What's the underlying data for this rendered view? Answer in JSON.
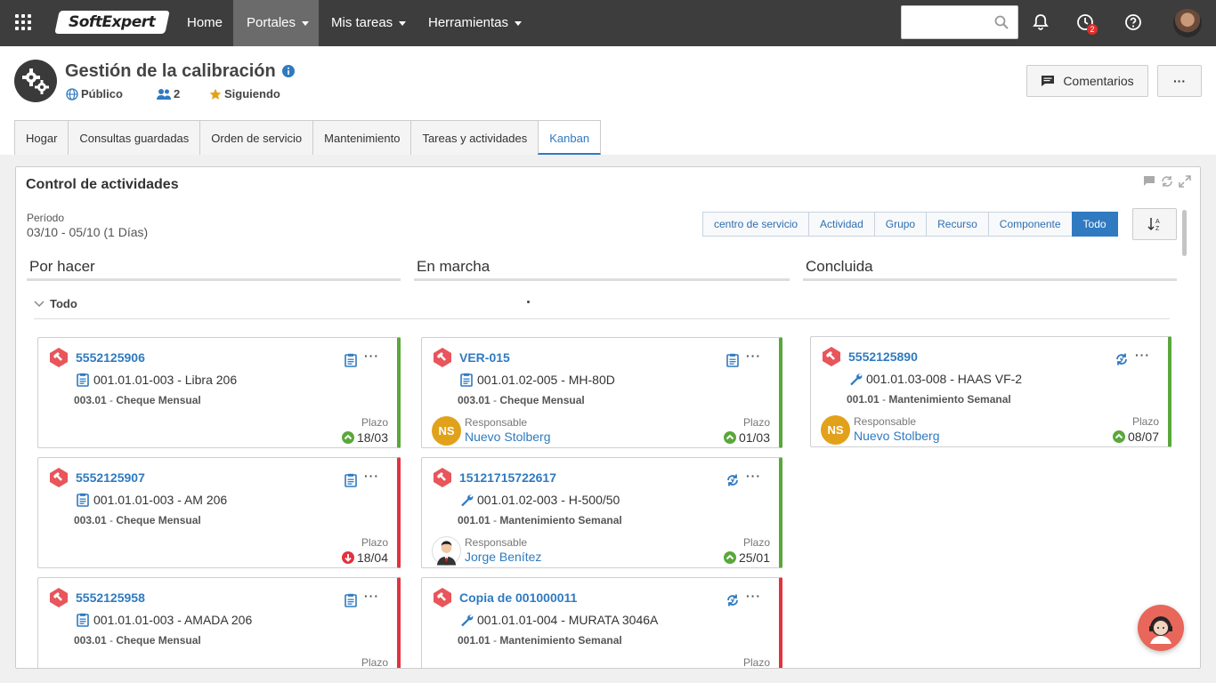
{
  "topnav": {
    "logo": "SoftExpert",
    "items": [
      {
        "label": "Home",
        "dropdown": false
      },
      {
        "label": "Portales",
        "dropdown": true
      },
      {
        "label": "Mis tareas",
        "dropdown": true
      },
      {
        "label": "Herramientas",
        "dropdown": true
      }
    ],
    "search_value": "",
    "badge_count": "2"
  },
  "header": {
    "title": "Gestión de la calibración",
    "visibility": "Público",
    "members": "2",
    "following": "Siguiendo",
    "comments_label": "Comentarios",
    "more_label": "···"
  },
  "tabs": [
    "Hogar",
    "Consultas guardadas",
    "Orden de servicio",
    "Mantenimiento",
    "Tareas y actividades",
    "Kanban"
  ],
  "active_tab": "Kanban",
  "panel": {
    "title": "Control de actividades",
    "period_label": "Período",
    "period_value": "03/10 - 05/10 (1 Días)",
    "filters": [
      "centro de servicio",
      "Actividad",
      "Grupo",
      "Recurso",
      "Componente",
      "Todo"
    ],
    "active_filter": "Todo",
    "group_label": "Todo"
  },
  "columns": [
    "Por hacer",
    "En marcha",
    "Concluida"
  ],
  "labels": {
    "plazo": "Plazo",
    "responsable": "Responsable"
  },
  "cards": [
    {
      "id": "5552125906",
      "item": "001.01.01-003 - Libra 206",
      "activity_code": "003.01",
      "activity": "Cheque Mensual",
      "date": "18/03",
      "status": "up",
      "accent": "green",
      "type": "clipboard"
    },
    {
      "id": "5552125907",
      "item": "001.01.01-003 - AM 206",
      "activity_code": "003.01",
      "activity": "Cheque Mensual",
      "date": "18/04",
      "status": "down",
      "accent": "red",
      "type": "clipboard"
    },
    {
      "id": "5552125958",
      "item": "001.01.01-003 - AMADA 206",
      "activity_code": "003.01",
      "activity": "Cheque Mensual",
      "date": "",
      "status": "",
      "accent": "red",
      "type": "clipboard"
    },
    {
      "id": "VER-015",
      "item": "001.01.02-005 - MH-80D",
      "activity_code": "003.01",
      "activity": "Cheque Mensual",
      "responsible": "Nuevo Stolberg",
      "initials": "NS",
      "date": "01/03",
      "status": "up",
      "accent": "green",
      "type": "clipboard"
    },
    {
      "id": "15121715722617",
      "item": "001.01.02-003 - H-500/50",
      "activity_code": "001.01",
      "activity": "Mantenimiento Semanal",
      "responsible": "Jorge Benítez",
      "initials": "",
      "date": "25/01",
      "status": "up",
      "accent": "green",
      "type": "cycle"
    },
    {
      "id": "Copia de 001000011",
      "item": "001.01.01-004 - MURATA 3046A",
      "activity_code": "001.01",
      "activity": "Mantenimiento Semanal",
      "date": "",
      "status": "",
      "accent": "red",
      "type": "cycle"
    },
    {
      "id": "5552125890",
      "item": "001.01.03-008 - HAAS VF-2",
      "activity_code": "001.01",
      "activity": "Mantenimiento Semanal",
      "responsible": "Nuevo Stolberg",
      "initials": "NS",
      "date": "08/07",
      "status": "up",
      "accent": "green",
      "type": "cycle"
    }
  ],
  "colors": {
    "topbar": "#3d3d3d",
    "accent": "#2f7ac0",
    "green": "#5aa73b",
    "red": "#e2333f",
    "hex_icon": "#e8555a"
  }
}
